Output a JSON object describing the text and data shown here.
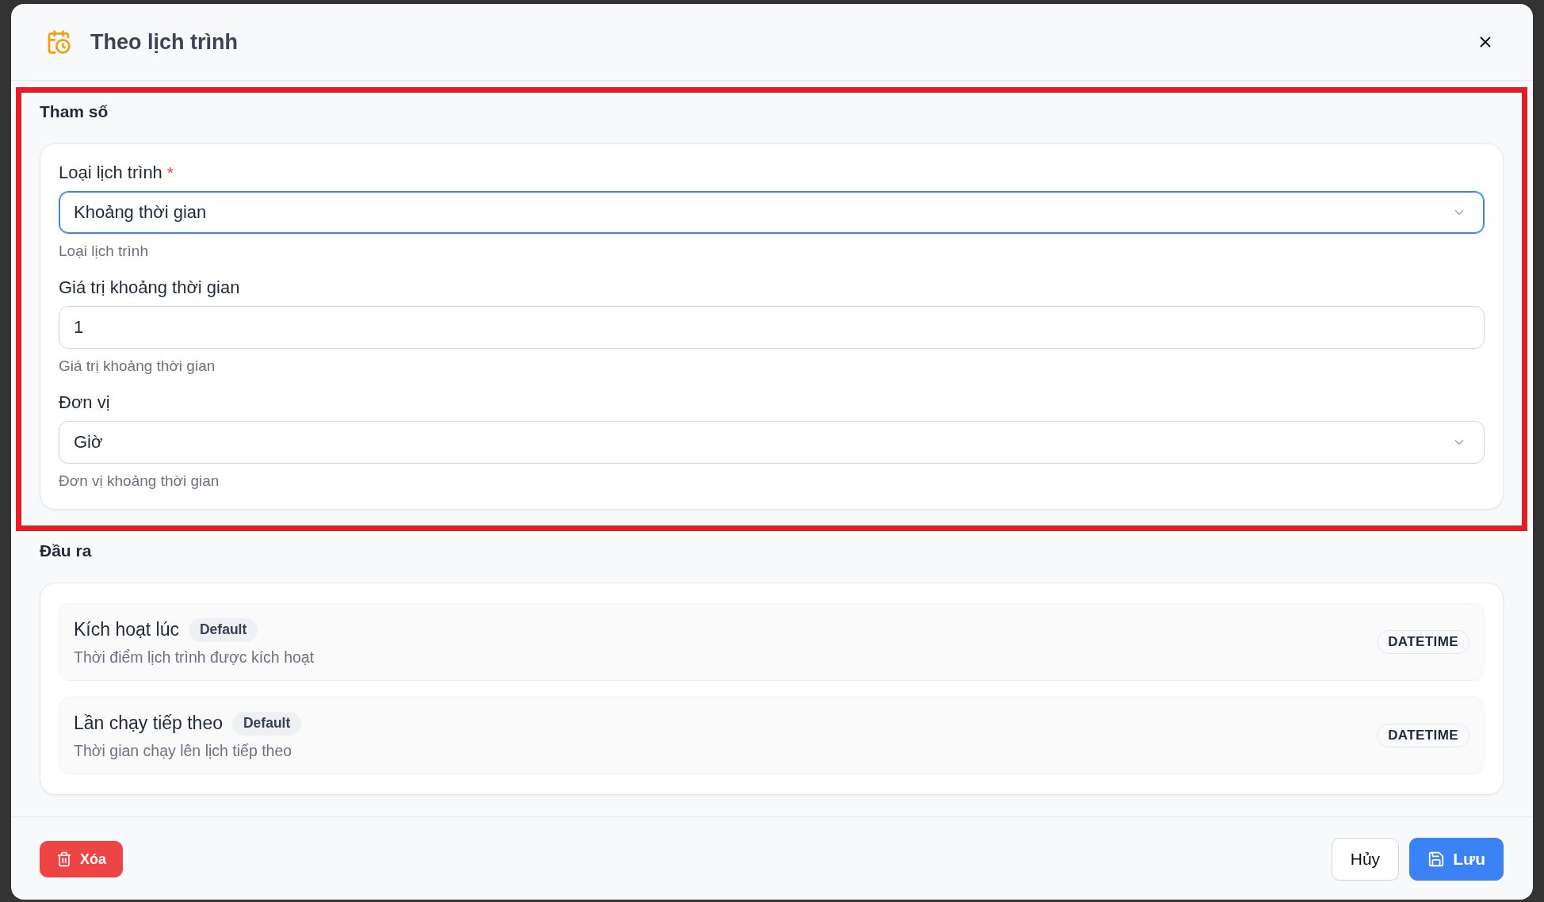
{
  "dialog": {
    "title": "Theo lịch trình"
  },
  "parameters": {
    "heading": "Tham số",
    "highlighted": true,
    "fields": [
      {
        "kind": "select",
        "label": "Loại lịch trình",
        "required_mark": "*",
        "value": "Khoảng thời gian",
        "focused": true,
        "help_text": "Loại lịch trình"
      },
      {
        "kind": "input",
        "label": "Giá trị khoảng thời gian",
        "value": "1",
        "focused": false,
        "help_text": "Giá trị khoảng thời gian"
      },
      {
        "kind": "select",
        "label": "Đơn vị",
        "value": "Giờ",
        "focused": false,
        "help_text": "Đơn vị khoảng thời gian"
      }
    ]
  },
  "outputs": {
    "heading": "Đầu ra",
    "items": [
      {
        "name": "Kích hoạt lúc",
        "badge": "Default",
        "description": "Thời điểm lịch trình được kích hoạt",
        "type": "DATETIME"
      },
      {
        "name": "Lần chạy tiếp theo",
        "badge": "Default",
        "description": "Thời gian chạy lên lịch tiếp theo",
        "type": "DATETIME"
      }
    ]
  },
  "footer": {
    "buttons": [
      {
        "kind": "delete",
        "label": "Xóa"
      },
      {
        "kind": "cancel",
        "label": "Hủy"
      },
      {
        "kind": "save",
        "label": "Lưu"
      }
    ]
  }
}
